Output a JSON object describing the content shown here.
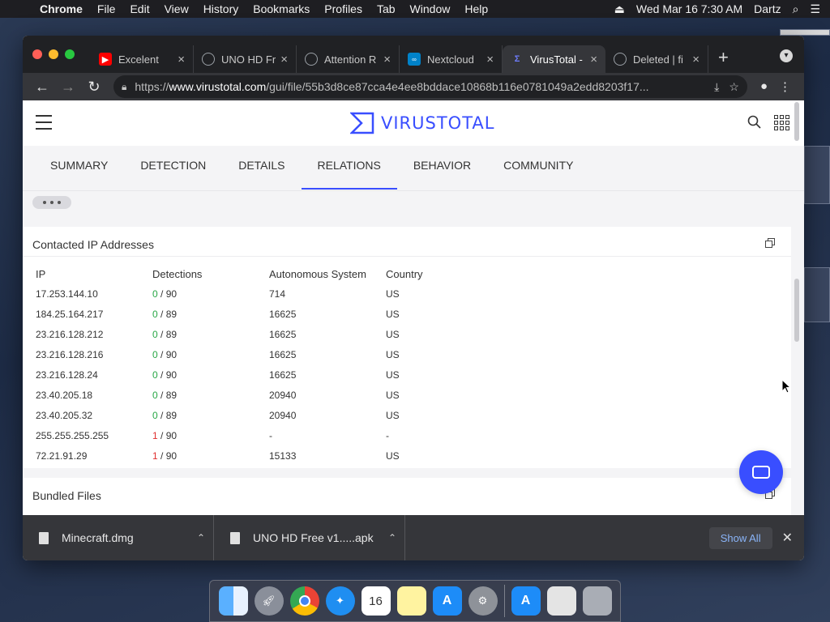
{
  "menubar": {
    "app_name": "Chrome",
    "menus": [
      "File",
      "Edit",
      "View",
      "History",
      "Bookmarks",
      "Profiles",
      "Tab",
      "Window",
      "Help"
    ],
    "datetime": "Wed Mar 16  7:30 AM",
    "user": "Dartz"
  },
  "browser": {
    "tabs": [
      {
        "label": "Excelent",
        "favicon": "youtube-icon",
        "color": "#ff0000"
      },
      {
        "label": "UNO HD Fr",
        "favicon": "globe-icon",
        "color": "#9aa0a6"
      },
      {
        "label": "Attention R",
        "favicon": "globe-icon",
        "color": "#9aa0a6"
      },
      {
        "label": "Nextcloud",
        "favicon": "nextcloud-icon",
        "color": "#0082c9"
      },
      {
        "label": "VirusTotal -",
        "favicon": "virustotal-icon",
        "color": "#394eff"
      },
      {
        "label": "Deleted | fi",
        "favicon": "globe-icon",
        "color": "#9aa0a6"
      }
    ],
    "active_tab_index": 4,
    "url_prefix": "https://",
    "url_domain": "www.virustotal.com",
    "url_path": "/gui/file/55b3d8ce87cca4e4ee8bddace10868b116e0781049a2edd8203f17..."
  },
  "page": {
    "logo_text": "VIRUSTOTAL",
    "nav_tabs": [
      "SUMMARY",
      "DETECTION",
      "DETAILS",
      "RELATIONS",
      "BEHAVIOR",
      "COMMUNITY"
    ],
    "active_nav_index": 3,
    "contacted_ips": {
      "title": "Contacted IP Addresses",
      "headers": [
        "IP",
        "Detections",
        "Autonomous System",
        "Country"
      ],
      "rows": [
        {
          "ip": "17.253.144.10",
          "det": "0",
          "total": "/ 90",
          "asn": "714",
          "country": "US"
        },
        {
          "ip": "184.25.164.217",
          "det": "0",
          "total": "/ 89",
          "asn": "16625",
          "country": "US"
        },
        {
          "ip": "23.216.128.212",
          "det": "0",
          "total": "/ 89",
          "asn": "16625",
          "country": "US"
        },
        {
          "ip": "23.216.128.216",
          "det": "0",
          "total": "/ 90",
          "asn": "16625",
          "country": "US"
        },
        {
          "ip": "23.216.128.24",
          "det": "0",
          "total": "/ 90",
          "asn": "16625",
          "country": "US"
        },
        {
          "ip": "23.40.205.18",
          "det": "0",
          "total": "/ 89",
          "asn": "20940",
          "country": "US"
        },
        {
          "ip": "23.40.205.32",
          "det": "0",
          "total": "/ 89",
          "asn": "20940",
          "country": "US"
        },
        {
          "ip": "255.255.255.255",
          "det": "1",
          "total": "/ 90",
          "asn": "-",
          "country": "-"
        },
        {
          "ip": "72.21.91.29",
          "det": "1",
          "total": "/ 90",
          "asn": "15133",
          "country": "US"
        }
      ]
    },
    "bundled_files": {
      "title": "Bundled Files"
    }
  },
  "downloads": {
    "items": [
      "Minecraft.dmg",
      "UNO HD Free v1.....apk"
    ],
    "show_all": "Show All"
  },
  "colors": {
    "accent": "#394eff",
    "clean": "#27a745",
    "malicious": "#e02f2f"
  }
}
